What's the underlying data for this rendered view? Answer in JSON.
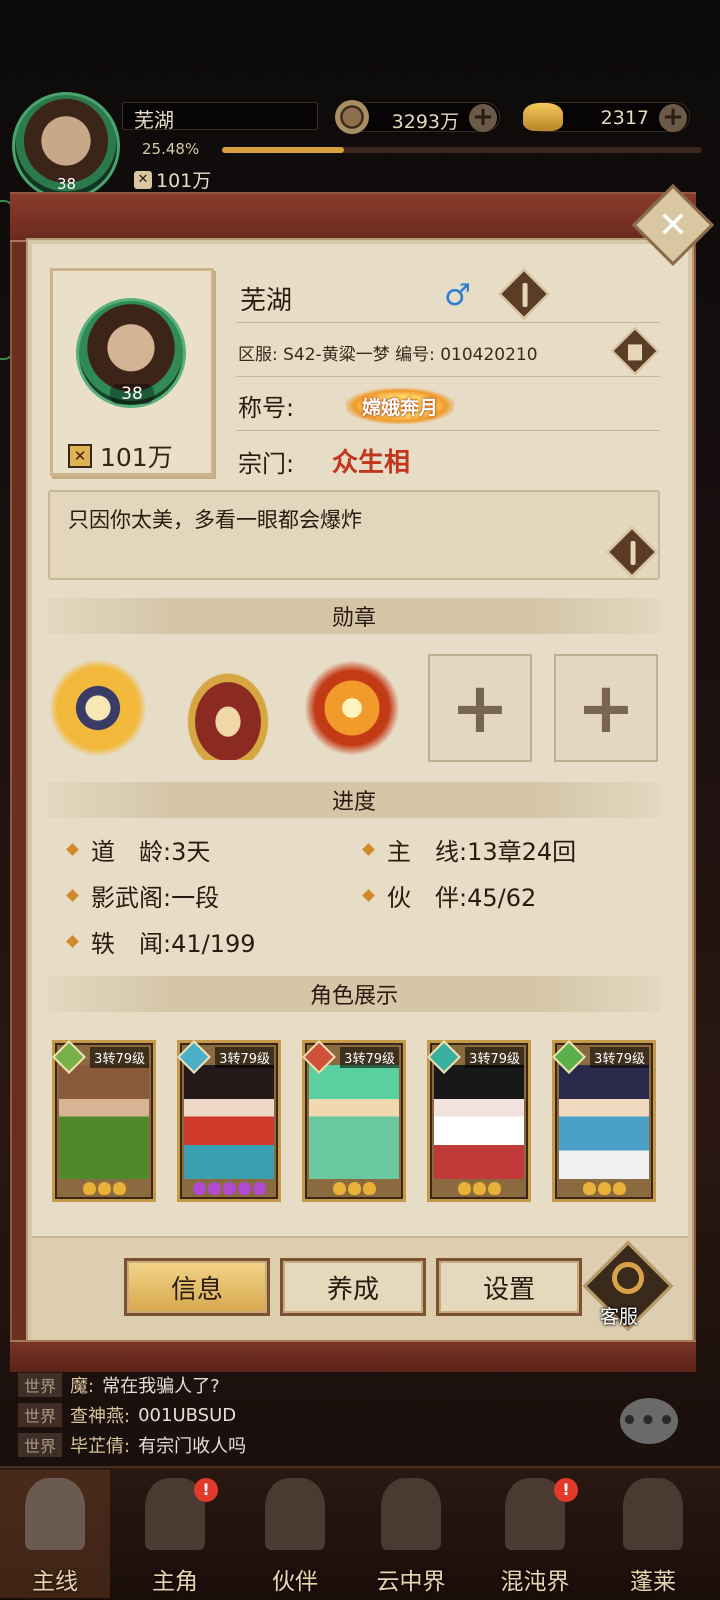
{
  "hud": {
    "name": "芜湖",
    "exp_percent": "25.48%",
    "exp_fraction": 0.2548,
    "power": "101万",
    "avatar_level": "38",
    "copper": "3293万",
    "gold": "2317"
  },
  "profile": {
    "name": "芜湖",
    "gender_symbol": "♂",
    "server_line": "区服: S42-黄粱一梦 编号: 010420210",
    "title_label": "称号:",
    "title_badge": "嫦娥奔月",
    "sect_label": "宗门:",
    "sect_value": "众生相",
    "level": "38",
    "power": "101万",
    "signature": "只因你太美，多看一眼都会爆炸"
  },
  "sections": {
    "medals": "勋章",
    "progress": "进度",
    "characters": "角色展示"
  },
  "progress": {
    "days": "道　龄:3天",
    "mainline": "主　线:13章24回",
    "shadow": "影武阁:一段",
    "partner": "伙　伴:45/62",
    "iron": "轶　闻:41/199"
  },
  "characters": [
    {
      "tier": "3转79级",
      "stars": 3,
      "star_color": "#e8b23a",
      "elem_color": "#7ab04a"
    },
    {
      "tier": "3转79级",
      "stars": 5,
      "star_color": "#b04ad0",
      "elem_color": "#4ab0c8"
    },
    {
      "tier": "3转79级",
      "stars": 3,
      "star_color": "#e8b23a",
      "elem_color": "#d0503a"
    },
    {
      "tier": "3转79级",
      "stars": 3,
      "star_color": "#e8b23a",
      "elem_color": "#3ab0a0"
    },
    {
      "tier": "3转79级",
      "stars": 3,
      "star_color": "#e8b23a",
      "elem_color": "#5ab04a"
    }
  ],
  "actions": {
    "info": "信息",
    "develop": "养成",
    "settings": "设置",
    "service": "客服"
  },
  "chat": [
    {
      "channel": "世界",
      "who": "魔:",
      "msg": "常在我骗人了?"
    },
    {
      "channel": "世界",
      "who": "查神燕:",
      "msg": "001UBSUD"
    },
    {
      "channel": "世界",
      "who": "毕芷倩:",
      "msg": "有宗门收人吗"
    }
  ],
  "nav": [
    {
      "label": "主线",
      "badge": ""
    },
    {
      "label": "主角",
      "badge": "!"
    },
    {
      "label": "伙伴",
      "badge": ""
    },
    {
      "label": "云中界",
      "badge": ""
    },
    {
      "label": "混沌界",
      "badge": "!"
    },
    {
      "label": "蓬莱",
      "badge": ""
    }
  ]
}
